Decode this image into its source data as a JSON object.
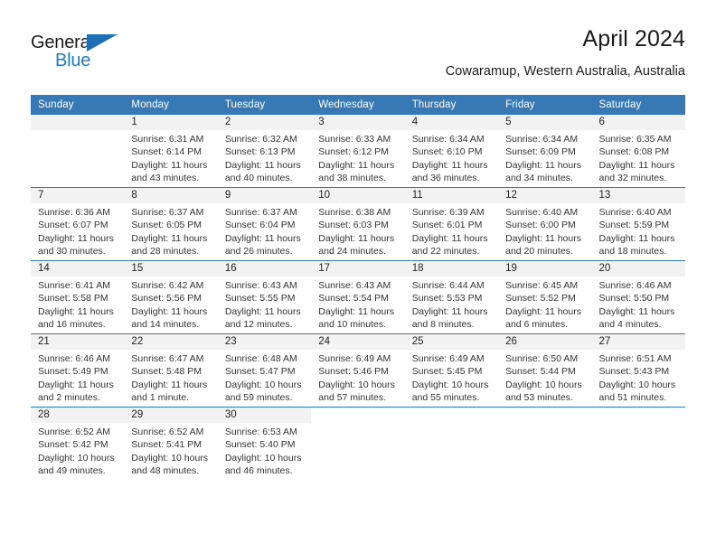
{
  "brand": {
    "word_one": "General",
    "word_two": "Blue",
    "triangle_color": "#1f6fb5"
  },
  "header": {
    "title": "April 2024",
    "location": "Cowaramup, Western Australia, Australia"
  },
  "theme": {
    "header_blue": "#3778b5",
    "daynum_bg": "#f2f2f2",
    "text": "#222222"
  },
  "calendar": {
    "weekday_headers": [
      "Sunday",
      "Monday",
      "Tuesday",
      "Wednesday",
      "Thursday",
      "Friday",
      "Saturday"
    ],
    "weeks": [
      [
        {
          "day": "",
          "shaded": true,
          "lines": []
        },
        {
          "day": "1",
          "shaded": true,
          "lines": [
            "Sunrise: 6:31 AM",
            "Sunset: 6:14 PM",
            "Daylight: 11 hours",
            "and 43 minutes."
          ]
        },
        {
          "day": "2",
          "shaded": true,
          "lines": [
            "Sunrise: 6:32 AM",
            "Sunset: 6:13 PM",
            "Daylight: 11 hours",
            "and 40 minutes."
          ]
        },
        {
          "day": "3",
          "shaded": true,
          "lines": [
            "Sunrise: 6:33 AM",
            "Sunset: 6:12 PM",
            "Daylight: 11 hours",
            "and 38 minutes."
          ]
        },
        {
          "day": "4",
          "shaded": true,
          "lines": [
            "Sunrise: 6:34 AM",
            "Sunset: 6:10 PM",
            "Daylight: 11 hours",
            "and 36 minutes."
          ]
        },
        {
          "day": "5",
          "shaded": true,
          "lines": [
            "Sunrise: 6:34 AM",
            "Sunset: 6:09 PM",
            "Daylight: 11 hours",
            "and 34 minutes."
          ]
        },
        {
          "day": "6",
          "shaded": true,
          "lines": [
            "Sunrise: 6:35 AM",
            "Sunset: 6:08 PM",
            "Daylight: 11 hours",
            "and 32 minutes."
          ]
        }
      ],
      [
        {
          "day": "7",
          "shaded": true,
          "lines": [
            "Sunrise: 6:36 AM",
            "Sunset: 6:07 PM",
            "Daylight: 11 hours",
            "and 30 minutes."
          ]
        },
        {
          "day": "8",
          "shaded": true,
          "lines": [
            "Sunrise: 6:37 AM",
            "Sunset: 6:05 PM",
            "Daylight: 11 hours",
            "and 28 minutes."
          ]
        },
        {
          "day": "9",
          "shaded": true,
          "lines": [
            "Sunrise: 6:37 AM",
            "Sunset: 6:04 PM",
            "Daylight: 11 hours",
            "and 26 minutes."
          ]
        },
        {
          "day": "10",
          "shaded": true,
          "lines": [
            "Sunrise: 6:38 AM",
            "Sunset: 6:03 PM",
            "Daylight: 11 hours",
            "and 24 minutes."
          ]
        },
        {
          "day": "11",
          "shaded": true,
          "lines": [
            "Sunrise: 6:39 AM",
            "Sunset: 6:01 PM",
            "Daylight: 11 hours",
            "and 22 minutes."
          ]
        },
        {
          "day": "12",
          "shaded": true,
          "lines": [
            "Sunrise: 6:40 AM",
            "Sunset: 6:00 PM",
            "Daylight: 11 hours",
            "and 20 minutes."
          ]
        },
        {
          "day": "13",
          "shaded": true,
          "lines": [
            "Sunrise: 6:40 AM",
            "Sunset: 5:59 PM",
            "Daylight: 11 hours",
            "and 18 minutes."
          ]
        }
      ],
      [
        {
          "day": "14",
          "shaded": true,
          "lines": [
            "Sunrise: 6:41 AM",
            "Sunset: 5:58 PM",
            "Daylight: 11 hours",
            "and 16 minutes."
          ]
        },
        {
          "day": "15",
          "shaded": true,
          "lines": [
            "Sunrise: 6:42 AM",
            "Sunset: 5:56 PM",
            "Daylight: 11 hours",
            "and 14 minutes."
          ]
        },
        {
          "day": "16",
          "shaded": true,
          "lines": [
            "Sunrise: 6:43 AM",
            "Sunset: 5:55 PM",
            "Daylight: 11 hours",
            "and 12 minutes."
          ]
        },
        {
          "day": "17",
          "shaded": true,
          "lines": [
            "Sunrise: 6:43 AM",
            "Sunset: 5:54 PM",
            "Daylight: 11 hours",
            "and 10 minutes."
          ]
        },
        {
          "day": "18",
          "shaded": true,
          "lines": [
            "Sunrise: 6:44 AM",
            "Sunset: 5:53 PM",
            "Daylight: 11 hours",
            "and 8 minutes."
          ]
        },
        {
          "day": "19",
          "shaded": true,
          "lines": [
            "Sunrise: 6:45 AM",
            "Sunset: 5:52 PM",
            "Daylight: 11 hours",
            "and 6 minutes."
          ]
        },
        {
          "day": "20",
          "shaded": true,
          "lines": [
            "Sunrise: 6:46 AM",
            "Sunset: 5:50 PM",
            "Daylight: 11 hours",
            "and 4 minutes."
          ]
        }
      ],
      [
        {
          "day": "21",
          "shaded": true,
          "lines": [
            "Sunrise: 6:46 AM",
            "Sunset: 5:49 PM",
            "Daylight: 11 hours",
            "and 2 minutes."
          ]
        },
        {
          "day": "22",
          "shaded": true,
          "lines": [
            "Sunrise: 6:47 AM",
            "Sunset: 5:48 PM",
            "Daylight: 11 hours",
            "and 1 minute."
          ]
        },
        {
          "day": "23",
          "shaded": true,
          "lines": [
            "Sunrise: 6:48 AM",
            "Sunset: 5:47 PM",
            "Daylight: 10 hours",
            "and 59 minutes."
          ]
        },
        {
          "day": "24",
          "shaded": true,
          "lines": [
            "Sunrise: 6:49 AM",
            "Sunset: 5:46 PM",
            "Daylight: 10 hours",
            "and 57 minutes."
          ]
        },
        {
          "day": "25",
          "shaded": true,
          "lines": [
            "Sunrise: 6:49 AM",
            "Sunset: 5:45 PM",
            "Daylight: 10 hours",
            "and 55 minutes."
          ]
        },
        {
          "day": "26",
          "shaded": true,
          "lines": [
            "Sunrise: 6:50 AM",
            "Sunset: 5:44 PM",
            "Daylight: 10 hours",
            "and 53 minutes."
          ]
        },
        {
          "day": "27",
          "shaded": true,
          "lines": [
            "Sunrise: 6:51 AM",
            "Sunset: 5:43 PM",
            "Daylight: 10 hours",
            "and 51 minutes."
          ]
        }
      ],
      [
        {
          "day": "28",
          "shaded": true,
          "lines": [
            "Sunrise: 6:52 AM",
            "Sunset: 5:42 PM",
            "Daylight: 10 hours",
            "and 49 minutes."
          ]
        },
        {
          "day": "29",
          "shaded": true,
          "lines": [
            "Sunrise: 6:52 AM",
            "Sunset: 5:41 PM",
            "Daylight: 10 hours",
            "and 48 minutes."
          ]
        },
        {
          "day": "30",
          "shaded": true,
          "lines": [
            "Sunrise: 6:53 AM",
            "Sunset: 5:40 PM",
            "Daylight: 10 hours",
            "and 46 minutes."
          ]
        },
        {
          "day": "",
          "shaded": false,
          "lines": []
        },
        {
          "day": "",
          "shaded": false,
          "lines": []
        },
        {
          "day": "",
          "shaded": false,
          "lines": []
        },
        {
          "day": "",
          "shaded": false,
          "lines": []
        }
      ]
    ]
  }
}
